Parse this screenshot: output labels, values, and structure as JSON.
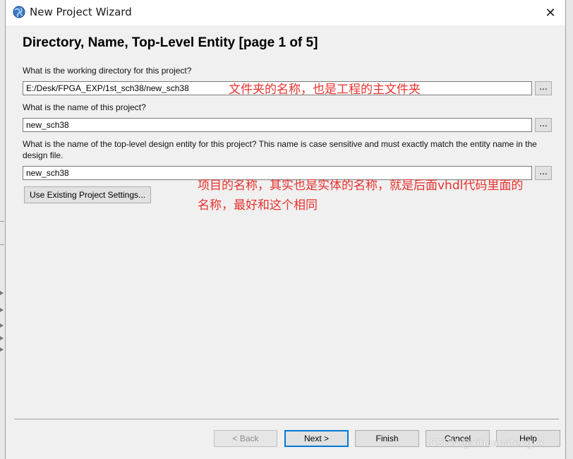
{
  "window": {
    "title": "New Project Wizard",
    "close_glyph": "✕",
    "icon": "globe-app-icon"
  },
  "page": {
    "heading": "Directory, Name, Top-Level Entity [page 1 of 5]"
  },
  "form": {
    "dir_question": "What is the working directory for this project?",
    "dir_value": "E:/Desk/FPGA_EXP/1st_sch38/new_sch38",
    "name_question": "What is the name of this project?",
    "name_value": "new_sch38",
    "entity_question": "What is the name of the top-level design entity for this project? This name is case sensitive and must exactly match the entity name in the design file.",
    "entity_value": "new_sch38",
    "browse_label": "...",
    "existing_settings_button": "Use Existing Project Settings..."
  },
  "annotations": {
    "dir_note": "文件夹的名称，也是工程的主文件夹",
    "name_note_line1": "项目的名称，其实也是实体的名称，就是后面vhdl代码里面的",
    "name_note_line2": "名称，最好和这个相同"
  },
  "footer": {
    "back": "< Back",
    "next": "Next >",
    "finish": "Finish",
    "cancel": "Cancel",
    "help": "Help"
  },
  "watermark": "CSDN @xihuanafengxx"
}
